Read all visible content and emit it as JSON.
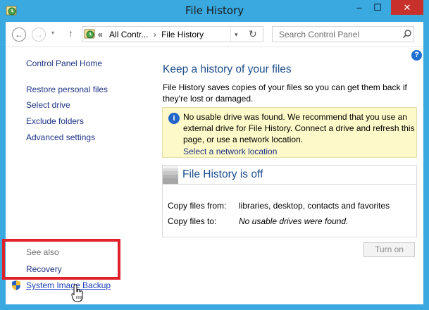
{
  "window": {
    "title": "File History",
    "minimize": "–",
    "maximize": "☐",
    "close": "✕"
  },
  "nav": {
    "back": "←",
    "forward": "→",
    "recent": "▾",
    "up": "↑",
    "address_prefix": "«",
    "address_parts": [
      "All Contr...",
      "File History"
    ],
    "address_sep": "›",
    "address_dropdown": "▾",
    "refresh": "↻",
    "search_placeholder": "Search Control Panel"
  },
  "left_pane": {
    "home": "Control Panel Home",
    "links": [
      "Restore personal files",
      "Select drive",
      "Exclude folders",
      "Advanced settings"
    ],
    "see_also_label": "See also",
    "recovery": "Recovery",
    "system_image_backup": "System Image Backup"
  },
  "main": {
    "help": "?",
    "title": "Keep a history of your files",
    "description": "File History saves copies of your files so you can get them back if they're lost or damaged.",
    "info": {
      "icon": "i",
      "message": "No usable drive was found. We recommend that you use an external drive for File History. Connect a drive and refresh this page, or use a network location.",
      "link": "Select a network location"
    },
    "status": {
      "title": "File History is off",
      "copy_from_label": "Copy files from:",
      "copy_from_value": "libraries, desktop, contacts and favorites",
      "copy_to_label": "Copy files to:",
      "copy_to_value": "No usable drives were found."
    },
    "turn_on_button": "Turn on"
  },
  "colors": {
    "frame": "#39a9e0",
    "close_button": "#c7302b",
    "link": "#1e3287",
    "heading": "#1e4e8c",
    "info_background": "#fdf9c8",
    "highlight_box": "#e0222a"
  }
}
